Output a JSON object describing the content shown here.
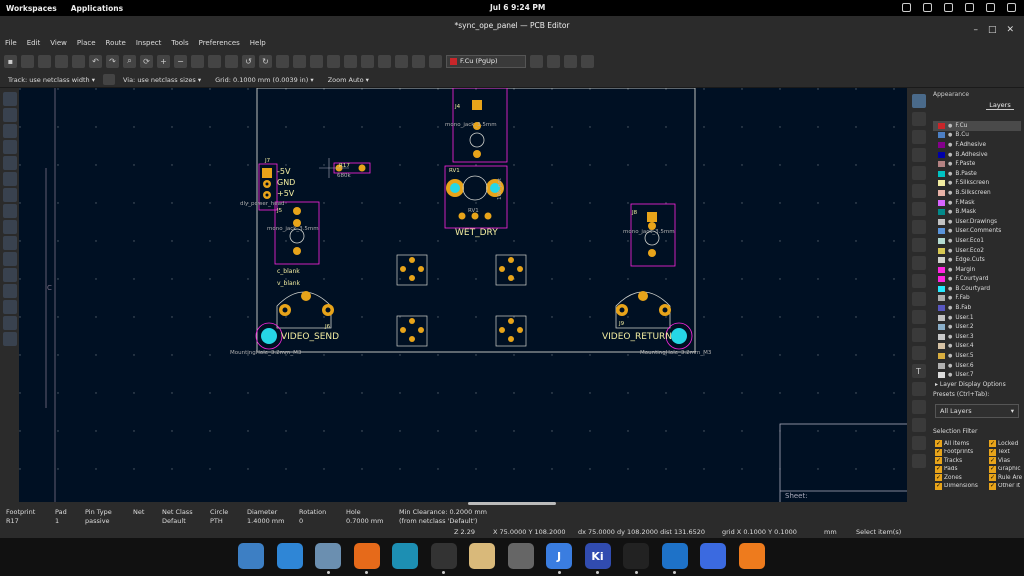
{
  "system": {
    "workspaces": "Workspaces",
    "applications": "Applications",
    "datetime": "Jul 6  9:24 PM"
  },
  "window": {
    "title": "*sync_ope_panel — PCB Editor"
  },
  "menu": [
    "File",
    "Edit",
    "View",
    "Place",
    "Route",
    "Inspect",
    "Tools",
    "Preferences",
    "Help"
  ],
  "toolbar": {
    "active_layer": "F.Cu (PgUp)"
  },
  "options": {
    "track": "Track: use netclass width",
    "via": "Via: use netclass sizes",
    "grid": "Grid: 0.1000 mm (0.0039 in)",
    "zoom": "Zoom Auto"
  },
  "board_labels": {
    "j7": "J7",
    "minus5": "-5V",
    "gnd": "GND",
    "plus5": "+5V",
    "dly": "dly_power_head",
    "j5": "J5",
    "mono5": "mono_jack_3.5mm",
    "r17": "R17",
    "r17val": "680k",
    "j4": "J4",
    "mono4": "mono_jack_3.5mm",
    "rv1": "RV1",
    "rv1b": "RV1",
    "pot": "10k_pot",
    "wetdry": "WET_DRY",
    "j8": "J8",
    "mono8": "mono_jack_3.5mm",
    "cblank": "c_blank",
    "vblank": "v_blank",
    "j6": "J6",
    "videosend": "VIDEO_SEND",
    "j9": "J9",
    "videoreturn": "VIDEO_RETURN",
    "mh1": "MountingHole_3.2mm_M3",
    "mh2": "MountingHole_3.2mm_M3",
    "sheet": "Sheet:"
  },
  "appearance": {
    "title": "Appearance",
    "tab": "Layers",
    "layers": [
      {
        "name": "F.Cu",
        "color": "#c8262a"
      },
      {
        "name": "B.Cu",
        "color": "#4d7fc4"
      },
      {
        "name": "F.Adhesive",
        "color": "#84008c"
      },
      {
        "name": "B.Adhesive",
        "color": "#0000a8"
      },
      {
        "name": "F.Paste",
        "color": "#b48282"
      },
      {
        "name": "B.Paste",
        "color": "#00c2c2"
      },
      {
        "name": "F.Silkscreen",
        "color": "#f2eda1"
      },
      {
        "name": "B.Silkscreen",
        "color": "#e8b2a7"
      },
      {
        "name": "F.Mask",
        "color": "#d864ff"
      },
      {
        "name": "B.Mask",
        "color": "#028a8a"
      },
      {
        "name": "User.Drawings",
        "color": "#c2c2c2"
      },
      {
        "name": "User.Comments",
        "color": "#5994dc"
      },
      {
        "name": "User.Eco1",
        "color": "#b4dbd2"
      },
      {
        "name": "User.Eco2",
        "color": "#d8c852"
      },
      {
        "name": "Edge.Cuts",
        "color": "#d0d2cd"
      },
      {
        "name": "Margin",
        "color": "#ff26e2"
      },
      {
        "name": "F.Courtyard",
        "color": "#ff26e2"
      },
      {
        "name": "B.Courtyard",
        "color": "#26e9ff"
      },
      {
        "name": "F.Fab",
        "color": "#afafaf"
      },
      {
        "name": "B.Fab",
        "color": "#5857c1"
      },
      {
        "name": "User.1",
        "color": "#c2c2c2"
      },
      {
        "name": "User.2",
        "color": "#89aec8"
      },
      {
        "name": "User.3",
        "color": "#c8c8c8"
      },
      {
        "name": "User.4",
        "color": "#d6c2a4"
      },
      {
        "name": "User.5",
        "color": "#d8ad3f"
      },
      {
        "name": "User.6",
        "color": "#b0b0b0"
      },
      {
        "name": "User.7",
        "color": "#dcdcdc"
      }
    ],
    "layer_display_options": "▸ Layer Display Options",
    "presets_label": "Presets (Ctrl+Tab):",
    "preset_value": "All Layers",
    "selection_filter": "Selection Filter",
    "filters": [
      "All items",
      "Locked",
      "Footprints",
      "Text",
      "Tracks",
      "Vias",
      "Pads",
      "Graphic",
      "Zones",
      "Rule Are",
      "Dimensions",
      "Other it"
    ]
  },
  "status": {
    "footprint_h": "Footprint",
    "footprint_v": "R17",
    "pad_h": "Pad",
    "pad_v": "1",
    "pintype_h": "Pin Type",
    "pintype_v": "passive",
    "net_h": "Net",
    "net_v": "",
    "netclass_h": "Net Class",
    "netclass_v": "Default",
    "circle_h": "Circle",
    "circle_v": "PTH",
    "diameter_h": "Diameter",
    "diameter_v": "1.4000 mm",
    "rotation_h": "Rotation",
    "rotation_v": "0",
    "hole_h": "Hole",
    "hole_v": "0.7000 mm",
    "clearance_h": "Min Clearance: 0.2000 mm",
    "clearance_v": "(from netclass 'Default')",
    "z": "Z 2.29",
    "xy": "X 75.0000  Y 108.2000",
    "dxdy": "dx 75.0000  dy 108.2000  dist 131.6520",
    "grid": "grid X 0.1000  Y 0.1000",
    "unit": "mm",
    "select": "Select item(s)"
  },
  "dock": [
    {
      "label": "",
      "color": "#3d7fc4"
    },
    {
      "label": "",
      "color": "#2f86d6"
    },
    {
      "label": "",
      "color": "#6b8fb0"
    },
    {
      "label": "",
      "color": "#e66a1a"
    },
    {
      "label": "",
      "color": "#1d8fb3"
    },
    {
      "label": "",
      "color": "#333"
    },
    {
      "label": "",
      "color": "#d9b97a"
    },
    {
      "label": "",
      "color": "#666"
    },
    {
      "label": "J",
      "color": "#3a7de0"
    },
    {
      "label": "Ki",
      "color": "#314cb0"
    },
    {
      "label": "",
      "color": "#222"
    },
    {
      "label": "",
      "color": "#1e72c8"
    },
    {
      "label": "",
      "color": "#3b6ae0"
    },
    {
      "label": "",
      "color": "#ee7b1d"
    }
  ]
}
